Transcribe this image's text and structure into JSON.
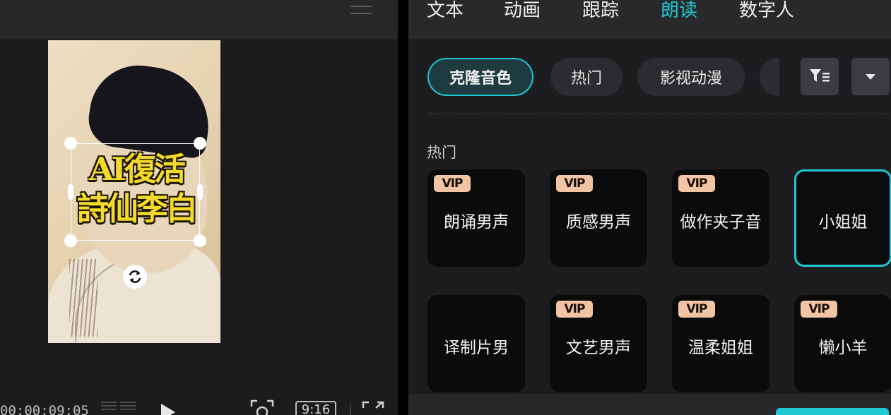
{
  "preview": {
    "caption_line1": "AI復活",
    "caption_line2": "詩仙李白",
    "timecode": "00:00:09:05",
    "aspect_ratio": "9:16"
  },
  "tabs": [
    {
      "label": "文本",
      "active": false
    },
    {
      "label": "动画",
      "active": false
    },
    {
      "label": "跟踪",
      "active": false
    },
    {
      "label": "朗读",
      "active": true
    },
    {
      "label": "数字人",
      "active": false
    }
  ],
  "filters": {
    "chips": [
      {
        "label": "克隆音色",
        "active": true
      },
      {
        "label": "热门",
        "active": false
      },
      {
        "label": "影视动漫",
        "active": false
      },
      {
        "label": "",
        "active": false
      }
    ],
    "filter_icon": "filter-icon",
    "dropdown_icon": "chevron-down-icon"
  },
  "section": {
    "label": "热门"
  },
  "voices": [
    {
      "label": "朗诵男声",
      "vip": true,
      "selected": false
    },
    {
      "label": "质感男声",
      "vip": true,
      "selected": false
    },
    {
      "label": "做作夹子音",
      "vip": true,
      "selected": false
    },
    {
      "label": "小姐姐",
      "vip": false,
      "selected": true
    },
    {
      "label": "译制片男",
      "vip": false,
      "selected": false
    },
    {
      "label": "文艺男声",
      "vip": true,
      "selected": false
    },
    {
      "label": "温柔姐姐",
      "vip": true,
      "selected": false
    },
    {
      "label": "懒小羊",
      "vip": true,
      "selected": false
    }
  ],
  "vip_badge": "VIP",
  "colors": {
    "accent": "#1fc7d5",
    "vip_badge": "#f1c4a3",
    "caption": "#f3da2a"
  }
}
